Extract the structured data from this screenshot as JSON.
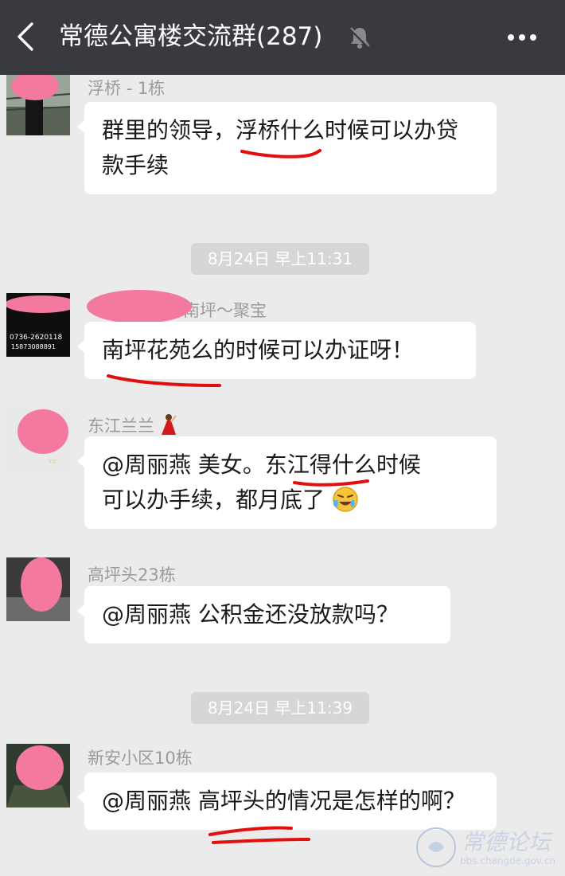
{
  "header": {
    "title": "常德公寓楼交流群(287)"
  },
  "messages": [
    {
      "sender": "浮桥 - 1栋",
      "text": "群里的领导，浮桥什么时候可以办贷款手续"
    },
    {
      "sender": "南坪～聚宝",
      "text": "南坪花苑么的时候可以办证呀！",
      "avatar_text_1": "0736-2620118",
      "avatar_text_2": "15873088891"
    },
    {
      "sender": "东江兰兰",
      "text_line1": "@周丽燕  美女。东江得什么时候",
      "text_line2": "可以办手续，都月底了"
    },
    {
      "sender": "高坪头23栋",
      "text": "@周丽燕  公积金还没放款吗？"
    },
    {
      "sender": "新安小区10栋",
      "text": "@周丽燕  高坪头的情况是怎样的啊？"
    }
  ],
  "timestamps": [
    "8月24日 早上11:31",
    "8月24日 早上11:39"
  ],
  "watermark": {
    "title": "常德论坛",
    "url": "bbs.changde.gov.cn"
  },
  "colors": {
    "topbar": "#393a3f",
    "background": "#ebebeb",
    "bubble": "#ffffff",
    "annotation": "#e01010",
    "censor": "#f4799e"
  }
}
